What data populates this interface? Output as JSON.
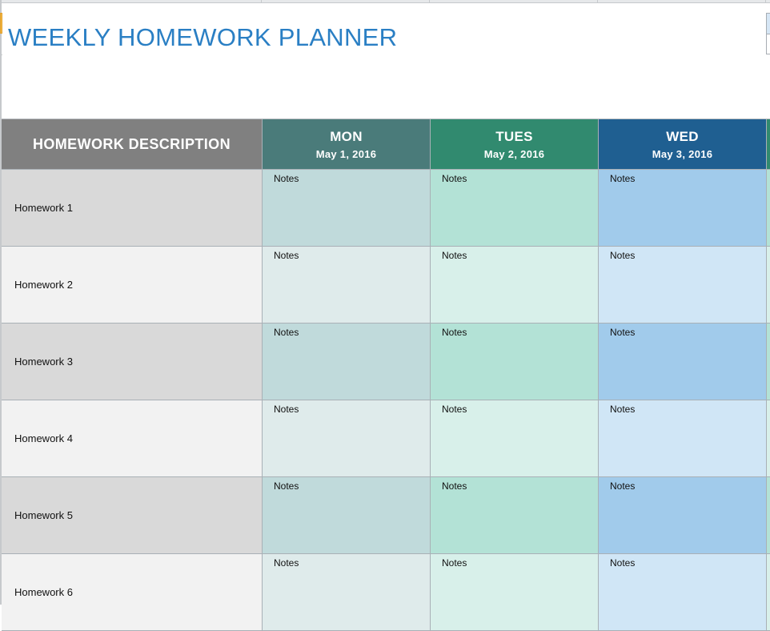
{
  "app": {
    "sheet_title": "WEEKLY HOMEWORK PLANNER"
  },
  "colors": {
    "title": "#2a7fc4",
    "header_desc": "#808080",
    "header_mon": "#4a7b7a",
    "header_tue": "#318a6f",
    "header_wed": "#1f5f91",
    "header_thu": "#318a6f",
    "desc_dark": "#d9d9d9",
    "desc_light": "#f2f2f2",
    "mon_dark": "#c0dadb",
    "mon_light": "#dfebeb",
    "tue_dark": "#b3e2d6",
    "tue_light": "#d8f0ea",
    "wed_dark": "#a1cbeb",
    "wed_light": "#d0e6f6",
    "thu_dark": "#b3e2d6",
    "thu_light": "#d8f0ea"
  },
  "table": {
    "desc_header": "HOMEWORK DESCRIPTION",
    "days": [
      {
        "name": "MON",
        "date": "May 1, 2016"
      },
      {
        "name": "TUES",
        "date": "May 2, 2016"
      },
      {
        "name": "WED",
        "date": "May 3, 2016"
      }
    ],
    "rows": [
      {
        "description": "Homework 1",
        "notes": [
          "Notes",
          "Notes",
          "Notes"
        ]
      },
      {
        "description": "Homework 2",
        "notes": [
          "Notes",
          "Notes",
          "Notes"
        ]
      },
      {
        "description": "Homework 3",
        "notes": [
          "Notes",
          "Notes",
          "Notes"
        ]
      },
      {
        "description": "Homework 4",
        "notes": [
          "Notes",
          "Notes",
          "Notes"
        ]
      },
      {
        "description": "Homework 5",
        "notes": [
          "Notes",
          "Notes",
          "Notes"
        ]
      },
      {
        "description": "Homework 6",
        "notes": [
          "Notes",
          "Notes",
          "Notes"
        ]
      }
    ]
  }
}
